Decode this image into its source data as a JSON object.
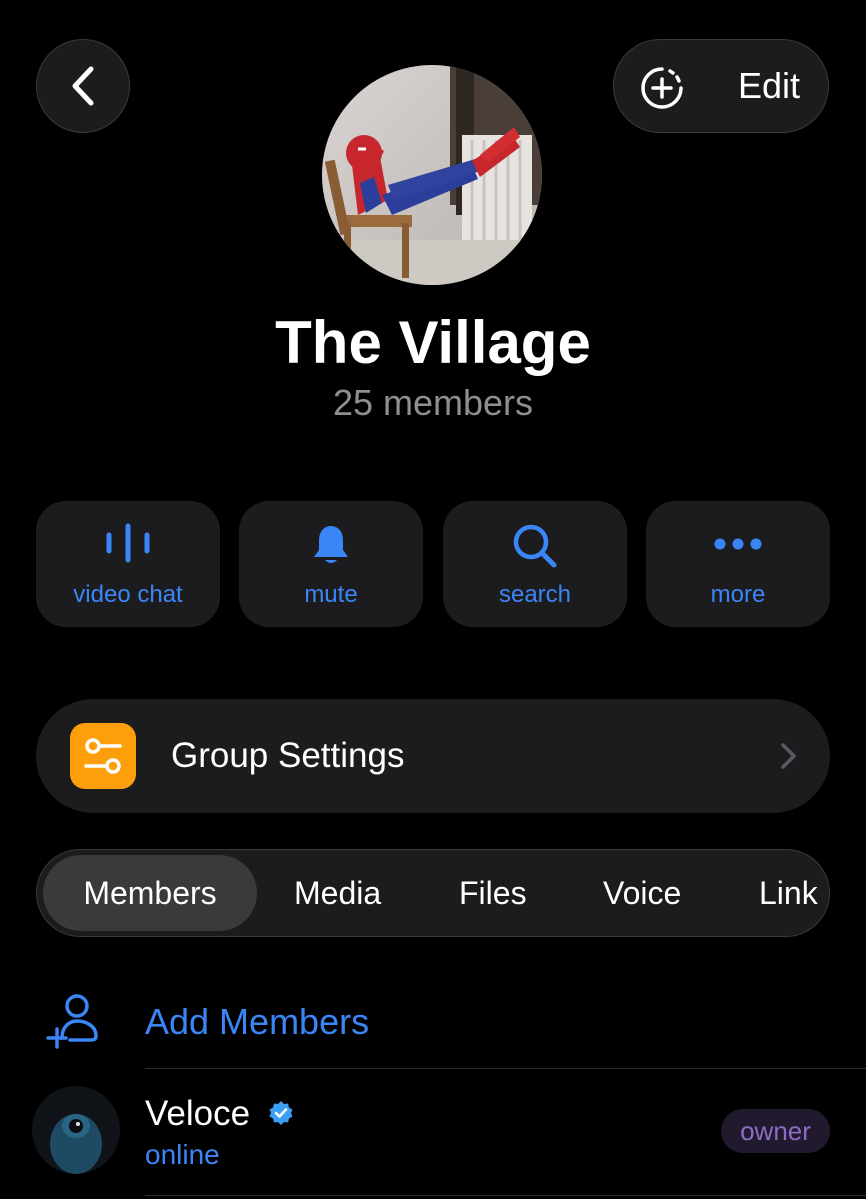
{
  "header": {
    "edit_label": "Edit"
  },
  "group": {
    "title": "The Village",
    "member_count": "25 members"
  },
  "actions": [
    {
      "label": "video chat",
      "icon": "voice-wave-icon"
    },
    {
      "label": "mute",
      "icon": "bell-icon"
    },
    {
      "label": "search",
      "icon": "search-icon"
    },
    {
      "label": "more",
      "icon": "ellipsis-icon"
    }
  ],
  "settings": {
    "label": "Group Settings",
    "icon": "sliders-icon"
  },
  "tabs": [
    {
      "label": "Members",
      "active": true
    },
    {
      "label": "Media",
      "active": false
    },
    {
      "label": "Files",
      "active": false
    },
    {
      "label": "Voice",
      "active": false
    },
    {
      "label": "Link",
      "active": false
    }
  ],
  "add_members": {
    "label": "Add Members"
  },
  "members": [
    {
      "name": "Veloce",
      "status": "online",
      "role": "owner",
      "verified": true
    }
  ],
  "colors": {
    "accent": "#3b86f7",
    "settings_tile": "#fd9f0b",
    "background": "#000000",
    "surface": "#1c1c1e",
    "owner_badge_text": "#8f6cc4"
  }
}
